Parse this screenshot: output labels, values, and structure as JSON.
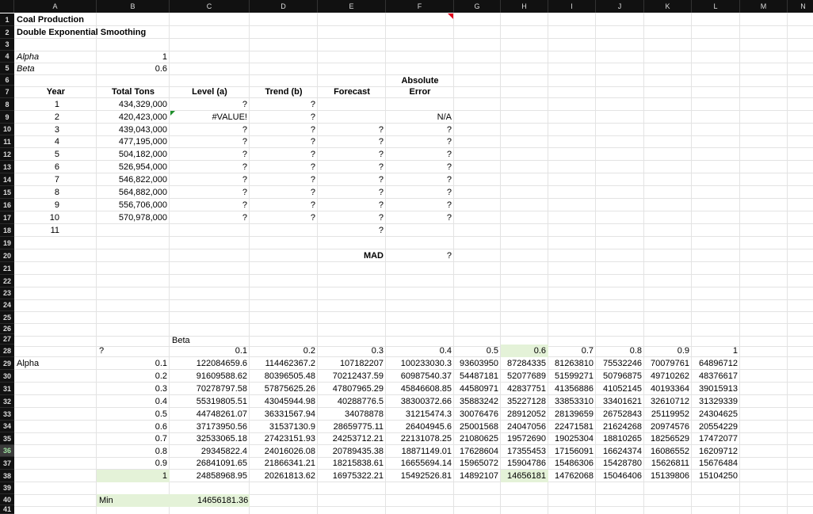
{
  "columns": [
    "A",
    "B",
    "C",
    "D",
    "E",
    "F",
    "G",
    "H",
    "I",
    "J",
    "K",
    "L",
    "M",
    "N"
  ],
  "rows": [
    "1",
    "2",
    "3",
    "4",
    "5",
    "6",
    "7",
    "8",
    "9",
    "10",
    "11",
    "12",
    "13",
    "14",
    "15",
    "16",
    "17",
    "18",
    "19",
    "20",
    "21",
    "22",
    "23",
    "24",
    "25",
    "26",
    "27",
    "28",
    "29",
    "30",
    "31",
    "32",
    "33",
    "34",
    "35",
    "36",
    "37",
    "38",
    "39",
    "40",
    "41"
  ],
  "title": "Coal Production",
  "subtitle": "Double Exponential Smoothing",
  "params": {
    "alpha_label": "Alpha",
    "alpha_value": "1",
    "beta_label": "Beta",
    "beta_value": "0.6"
  },
  "headers": {
    "year": "Year",
    "tons": "Total Tons",
    "level": "Level (a)",
    "trend": "Trend (b)",
    "forecast": "Forecast",
    "abs1": "Absolute",
    "abs2": "Error"
  },
  "table": [
    {
      "year": "1",
      "tons": "434,329,000",
      "level": "?",
      "trend": "?",
      "forecast": "",
      "error": ""
    },
    {
      "year": "2",
      "tons": "420,423,000",
      "level": "#VALUE!",
      "trend": "?",
      "forecast": "",
      "error": "N/A"
    },
    {
      "year": "3",
      "tons": "439,043,000",
      "level": "?",
      "trend": "?",
      "forecast": "?",
      "error": "?"
    },
    {
      "year": "4",
      "tons": "477,195,000",
      "level": "?",
      "trend": "?",
      "forecast": "?",
      "error": "?"
    },
    {
      "year": "5",
      "tons": "504,182,000",
      "level": "?",
      "trend": "?",
      "forecast": "?",
      "error": "?"
    },
    {
      "year": "6",
      "tons": "526,954,000",
      "level": "?",
      "trend": "?",
      "forecast": "?",
      "error": "?"
    },
    {
      "year": "7",
      "tons": "546,822,000",
      "level": "?",
      "trend": "?",
      "forecast": "?",
      "error": "?"
    },
    {
      "year": "8",
      "tons": "564,882,000",
      "level": "?",
      "trend": "?",
      "forecast": "?",
      "error": "?"
    },
    {
      "year": "9",
      "tons": "556,706,000",
      "level": "?",
      "trend": "?",
      "forecast": "?",
      "error": "?"
    },
    {
      "year": "10",
      "tons": "570,978,000",
      "level": "?",
      "trend": "?",
      "forecast": "?",
      "error": "?"
    },
    {
      "year": "11",
      "tons": "",
      "level": "",
      "trend": "",
      "forecast": "?",
      "error": ""
    }
  ],
  "mad_label": "MAD",
  "mad_value": "?",
  "grid": {
    "beta_label": "Beta",
    "corner": "?",
    "alpha_label": "Alpha",
    "betas": [
      "0.1",
      "0.2",
      "0.3",
      "0.4",
      "0.5",
      "0.6",
      "0.7",
      "0.8",
      "0.9",
      "1"
    ],
    "alphas": [
      "0.1",
      "0.2",
      "0.3",
      "0.4",
      "0.5",
      "0.6",
      "0.7",
      "0.8",
      "0.9",
      "1"
    ],
    "values": [
      [
        "122084659.6",
        "114462367.2",
        "107182207",
        "100233030.3",
        "93603950",
        "87284335",
        "81263810",
        "75532246",
        "70079761",
        "64896712"
      ],
      [
        "91609588.62",
        "80396505.48",
        "70212437.59",
        "60987540.37",
        "54487181",
        "52077689",
        "51599271",
        "50796875",
        "49710262",
        "48376617"
      ],
      [
        "70278797.58",
        "57875625.26",
        "47807965.29",
        "45846608.85",
        "44580971",
        "42837751",
        "41356886",
        "41052145",
        "40193364",
        "39015913"
      ],
      [
        "55319805.51",
        "43045944.98",
        "40288776.5",
        "38300372.66",
        "35883242",
        "35227128",
        "33853310",
        "33401621",
        "32610712",
        "31329339"
      ],
      [
        "44748261.07",
        "36331567.94",
        "34078878",
        "31215474.3",
        "30076476",
        "28912052",
        "28139659",
        "26752843",
        "25119952",
        "24304625"
      ],
      [
        "37173950.56",
        "31537130.9",
        "28659775.11",
        "26404945.6",
        "25001568",
        "24047056",
        "22471581",
        "21624268",
        "20974576",
        "20554229"
      ],
      [
        "32533065.18",
        "27423151.93",
        "24253712.21",
        "22131078.25",
        "21080625",
        "19572690",
        "19025304",
        "18810265",
        "18256529",
        "17472077"
      ],
      [
        "29345822.4",
        "24016026.08",
        "20789435.38",
        "18871149.01",
        "17628604",
        "17355453",
        "17156091",
        "16624374",
        "16086552",
        "16209712"
      ],
      [
        "26841091.65",
        "21866341.21",
        "18215838.61",
        "16655694.14",
        "15965072",
        "15904786",
        "15486306",
        "15428780",
        "15626811",
        "15676484"
      ],
      [
        "24858968.95",
        "20261813.62",
        "16975322.21",
        "15492526.81",
        "14892107",
        "14656181",
        "14762068",
        "15046406",
        "15139806",
        "15104250"
      ]
    ],
    "min_label": "Min",
    "min_value": "14656181.36"
  }
}
